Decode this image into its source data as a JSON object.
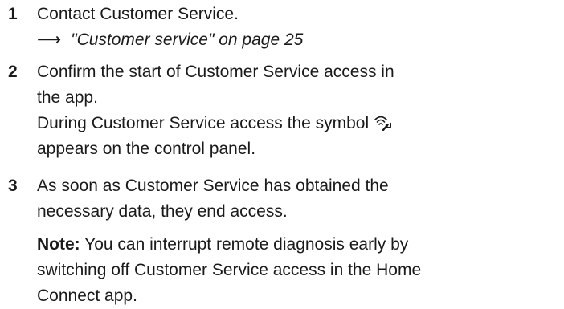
{
  "steps": [
    {
      "number": "1",
      "lines": [
        "Contact Customer Service."
      ],
      "reference": {
        "arrow": "⟶",
        "text": "\"Customer service\" on page 25"
      }
    },
    {
      "number": "2",
      "lines": [
        "Confirm the start of Customer Service access in",
        "the app."
      ],
      "info_line_before_icon": "During Customer Service access the symbol",
      "icon": "remote-service-icon",
      "info_line_after": "appears on the control panel."
    },
    {
      "number": "3",
      "lines": [
        "As soon as Customer Service has obtained the",
        "necessary data, they end access."
      ],
      "note": {
        "label": "Note:",
        "lines": [
          "You can interrupt remote diagnosis early by",
          "switching off Customer Service access in the Home",
          "Connect app."
        ]
      }
    }
  ]
}
